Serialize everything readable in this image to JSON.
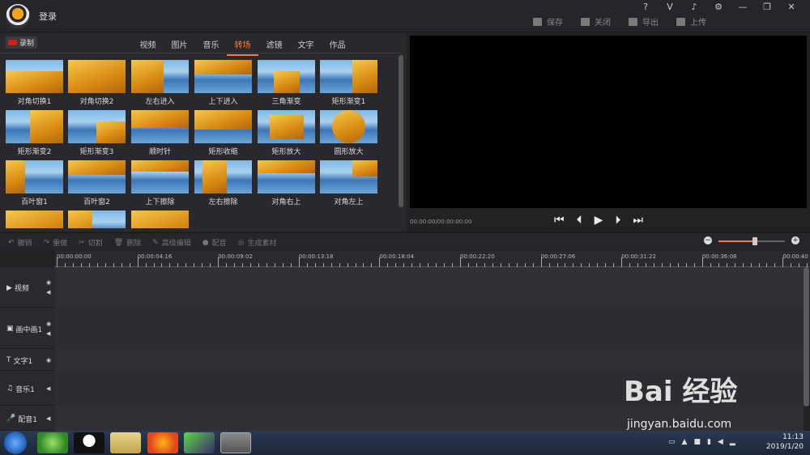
{
  "title": {
    "login": "登录"
  },
  "window_buttons": [
    "?",
    "V",
    "♪",
    "⚙",
    "—",
    "❐",
    "✕"
  ],
  "top_actions": [
    {
      "label": "保存",
      "icon": "save-icon"
    },
    {
      "label": "关闭",
      "icon": "exit-icon"
    },
    {
      "label": "导出",
      "icon": "export-icon"
    },
    {
      "label": "上传",
      "icon": "upload-icon"
    }
  ],
  "record": {
    "label": "录制"
  },
  "tabs": [
    {
      "label": "视频"
    },
    {
      "label": "图片"
    },
    {
      "label": "音乐"
    },
    {
      "label": "转场",
      "active": true
    },
    {
      "label": "滤镜"
    },
    {
      "label": "文字"
    },
    {
      "label": "作品"
    }
  ],
  "transitions": [
    "对角切换1",
    "对角切换2",
    "左右进入",
    "上下进入",
    "三角渐变",
    "矩形渐变1",
    "矩形渐变2",
    "矩形渐变3",
    "顺时针",
    "矩形收缩",
    "矩形放大",
    "圆形放大",
    "百叶窗1",
    "百叶窗2",
    "上下擦除",
    "左右擦除",
    "对角右上",
    "对角左上",
    "",
    "",
    ""
  ],
  "preview": {
    "time": "00:00:00/00:00:00:00"
  },
  "player_controls": [
    "⏮",
    "⏴",
    "▶",
    "⏵",
    "⏭"
  ],
  "toolbar": [
    {
      "label": "撤销"
    },
    {
      "label": "重做"
    },
    {
      "label": "切割"
    },
    {
      "label": "删除"
    },
    {
      "label": "高级编辑"
    },
    {
      "label": "配音"
    },
    {
      "label": "生成素材"
    }
  ],
  "zoom": {
    "level": 0.55
  },
  "ruler": [
    "00:00:00:00",
    "00:00:04:16",
    "00:00:09:02",
    "00:00:13:18",
    "00:00:18:04",
    "00:00:22:20",
    "00:00:27:06",
    "00:00:31:22",
    "00:00:36:08",
    "00:00:40"
  ],
  "tracks": [
    {
      "label": "视频",
      "icon": "▶"
    },
    {
      "label": "画中画1",
      "icon": "▣"
    },
    {
      "label": "文字1",
      "icon": "T"
    },
    {
      "label": "音乐1",
      "icon": "♫"
    },
    {
      "label": "配音1",
      "icon": "🎤"
    }
  ],
  "taskbar": {
    "time": "11:13",
    "date": "2019/1/20"
  },
  "watermark": {
    "brand": "Bai 经验",
    "url": "jingyan.baidu.com"
  }
}
